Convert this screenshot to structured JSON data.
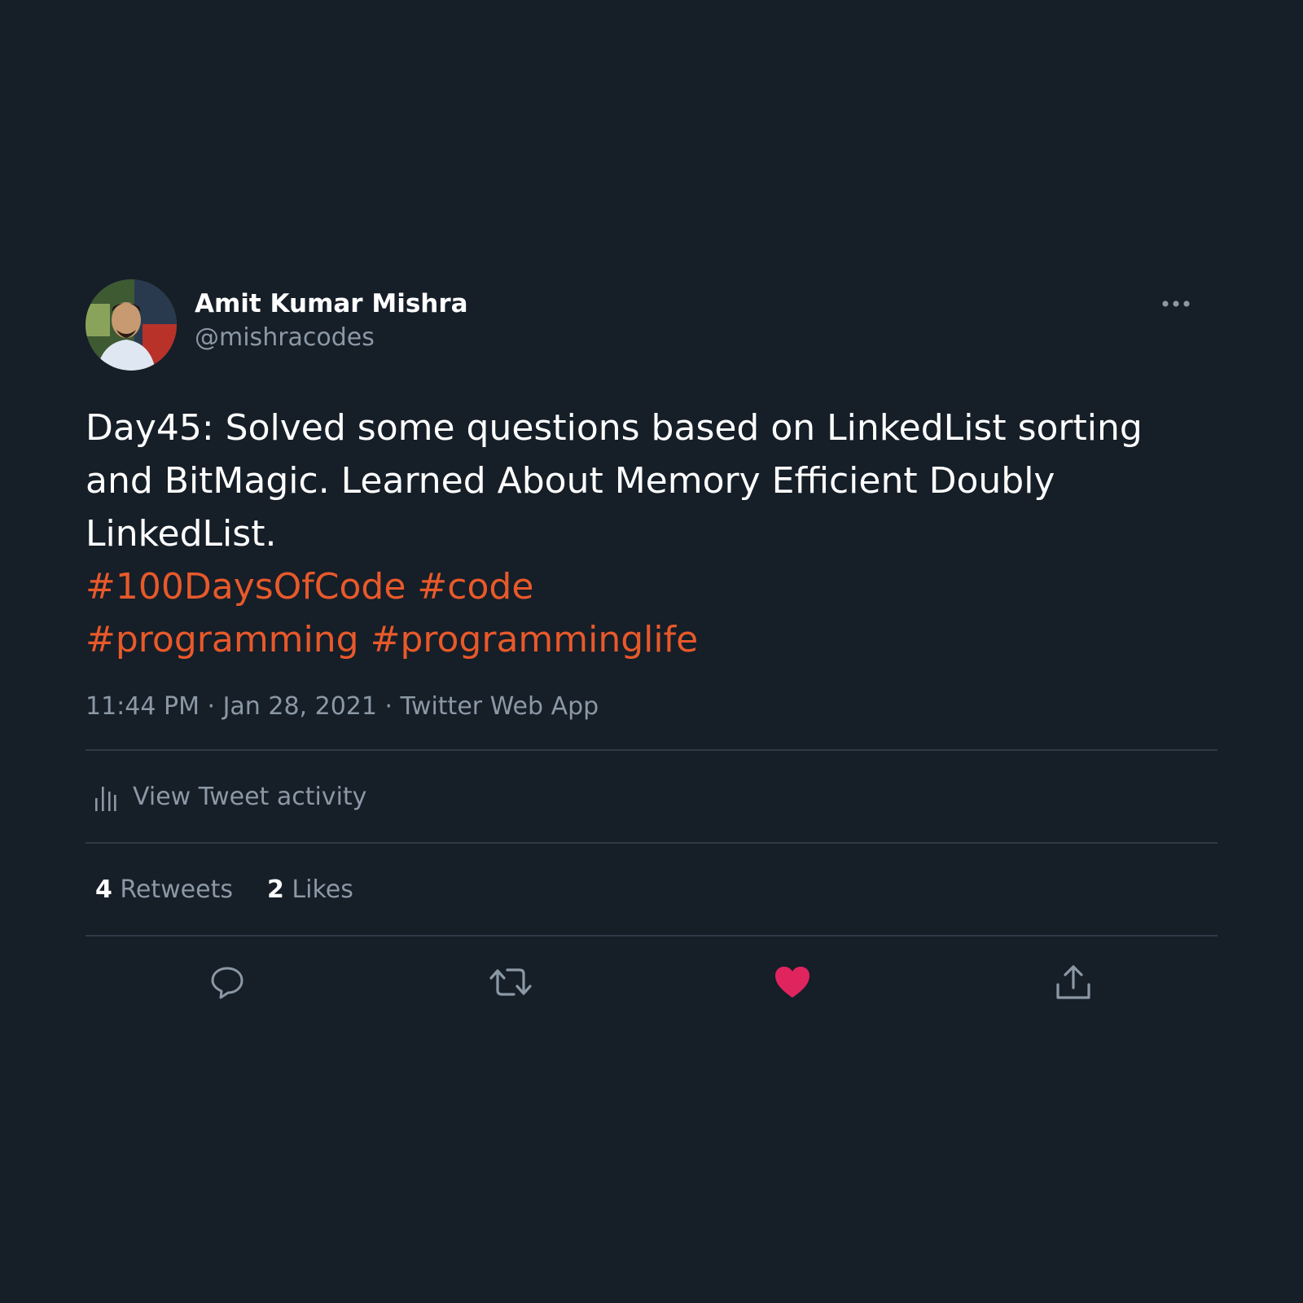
{
  "author": {
    "display_name": "Amit Kumar Mishra",
    "handle": "@mishracodes",
    "avatar_icon": "profile-photo"
  },
  "tweet": {
    "text_lines": [
      "Day45: Solved some questions based on LinkedList sorting",
      "and BitMagic. Learned About Memory Efficient Doubly",
      "LinkedList."
    ],
    "hashtag_lines": [
      [
        "#100DaysOfCode",
        "#code"
      ],
      [
        "#programming",
        "#programminglife"
      ]
    ],
    "timestamp": "11:44 PM · Jan 28, 2021 · Twitter Web App"
  },
  "activity": {
    "label": "View Tweet activity",
    "icon": "bar-chart-icon"
  },
  "stats": {
    "retweets_count": "4",
    "retweets_label": "Retweets",
    "likes_count": "2",
    "likes_label": "Likes"
  },
  "actions": {
    "reply_icon": "reply-icon",
    "retweet_icon": "retweet-icon",
    "like_icon": "heart-icon",
    "share_icon": "share-icon"
  },
  "colors": {
    "background": "#161e28",
    "hashtag": "#e8592a",
    "secondary_text": "#8b98a5",
    "like_active": "#e0245e"
  }
}
